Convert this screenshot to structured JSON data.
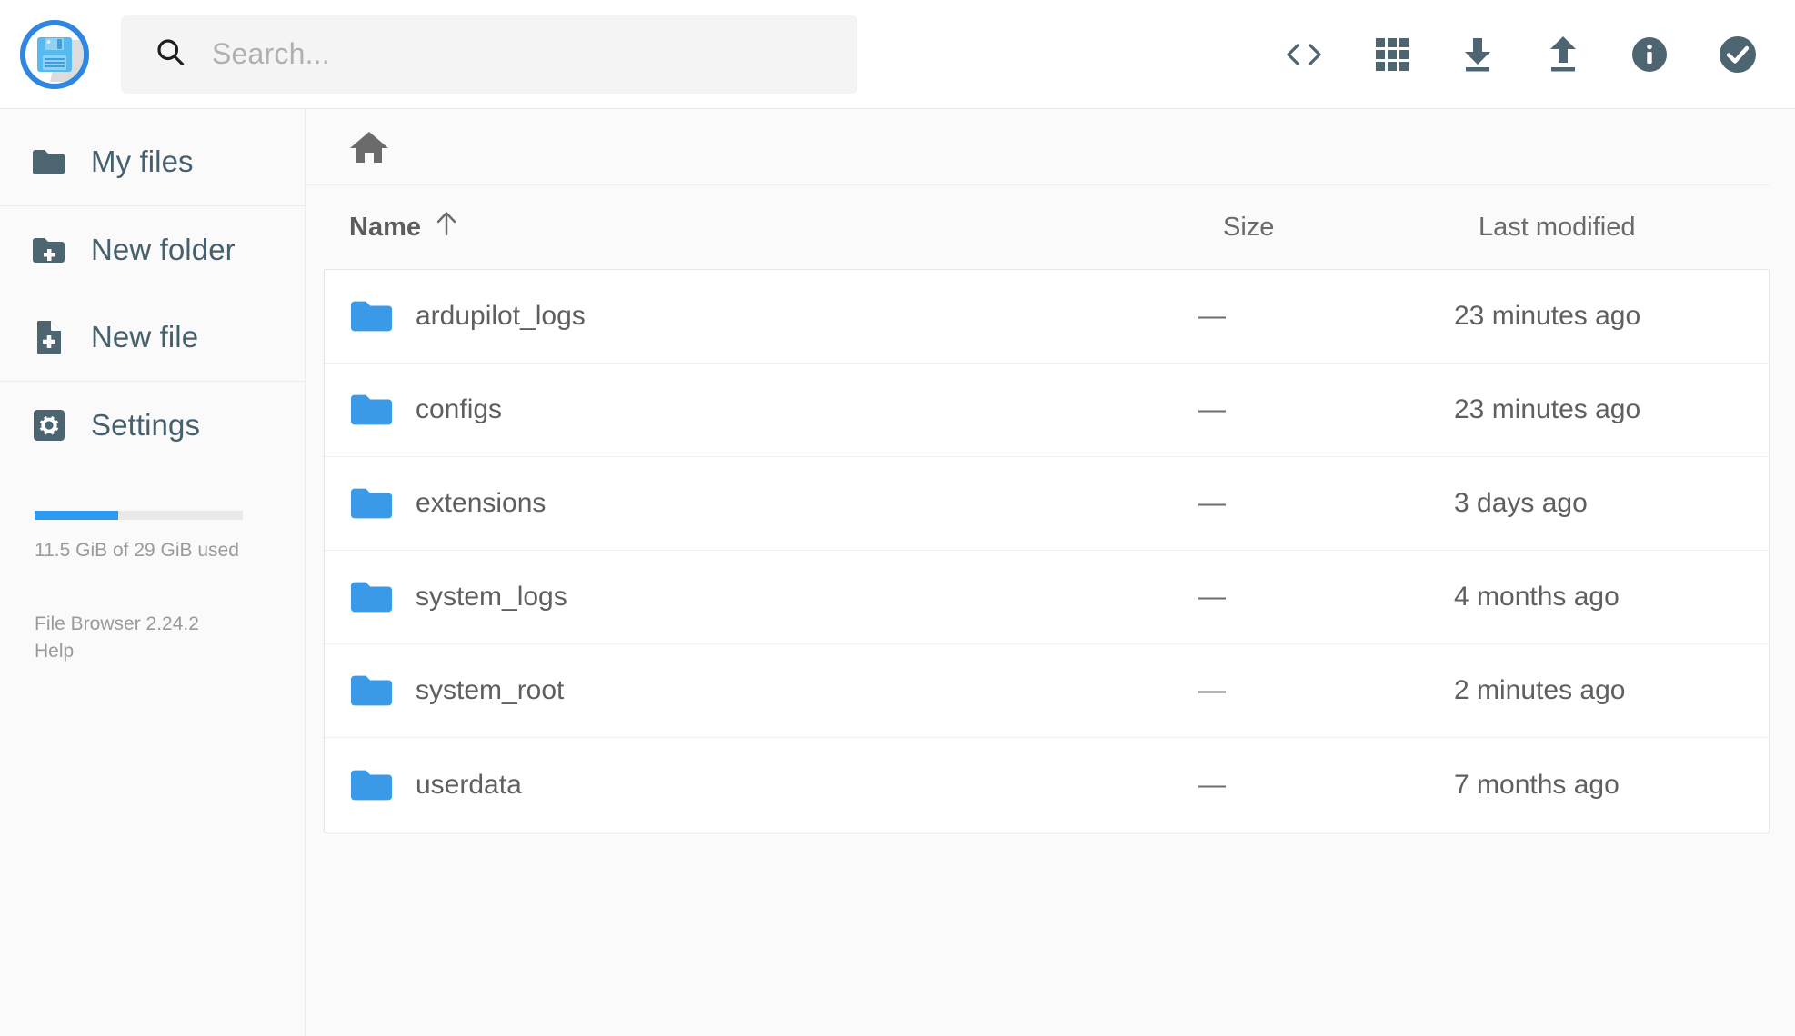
{
  "brand": {
    "logo_icon": "floppy-disk-icon",
    "accent_color": "#2e86e0"
  },
  "search": {
    "placeholder": "Search...",
    "value": "",
    "icon": "search-icon"
  },
  "toolbar": {
    "actions": [
      {
        "name": "code-brackets-icon",
        "label": "Shell"
      },
      {
        "name": "grid-view-icon",
        "label": "Switch view"
      },
      {
        "name": "download-icon",
        "label": "Download"
      },
      {
        "name": "upload-icon",
        "label": "Upload"
      },
      {
        "name": "info-icon",
        "label": "Info"
      },
      {
        "name": "check-circle-icon",
        "label": "Select multiple"
      }
    ]
  },
  "sidebar": {
    "items": [
      {
        "label": "My files",
        "icon": "folder-icon"
      },
      {
        "label": "New folder",
        "icon": "folder-plus-icon"
      },
      {
        "label": "New file",
        "icon": "file-plus-icon"
      },
      {
        "label": "Settings",
        "icon": "gear-icon"
      }
    ],
    "storage": {
      "used_percent": 40,
      "text": "11.5 GiB of 29 GiB used",
      "bar_color": "#2e9bf0"
    },
    "version": "File Browser 2.24.2",
    "help": "Help"
  },
  "breadcrumb": {
    "home_icon": "home-icon"
  },
  "listing": {
    "columns": {
      "name": "Name",
      "size": "Size",
      "modified": "Last modified"
    },
    "sort": {
      "column": "name",
      "direction": "asc",
      "icon": "arrow-up-icon"
    },
    "rows": [
      {
        "icon": "folder-icon",
        "name": "ardupilot_logs",
        "size": "—",
        "modified": "23 minutes ago"
      },
      {
        "icon": "folder-icon",
        "name": "configs",
        "size": "—",
        "modified": "23 minutes ago"
      },
      {
        "icon": "folder-icon",
        "name": "extensions",
        "size": "—",
        "modified": "3 days ago"
      },
      {
        "icon": "folder-icon",
        "name": "system_logs",
        "size": "—",
        "modified": "4 months ago"
      },
      {
        "icon": "folder-icon",
        "name": "system_root",
        "size": "—",
        "modified": "2 minutes ago"
      },
      {
        "icon": "folder-icon",
        "name": "userdata",
        "size": "—",
        "modified": "7 months ago"
      }
    ]
  }
}
